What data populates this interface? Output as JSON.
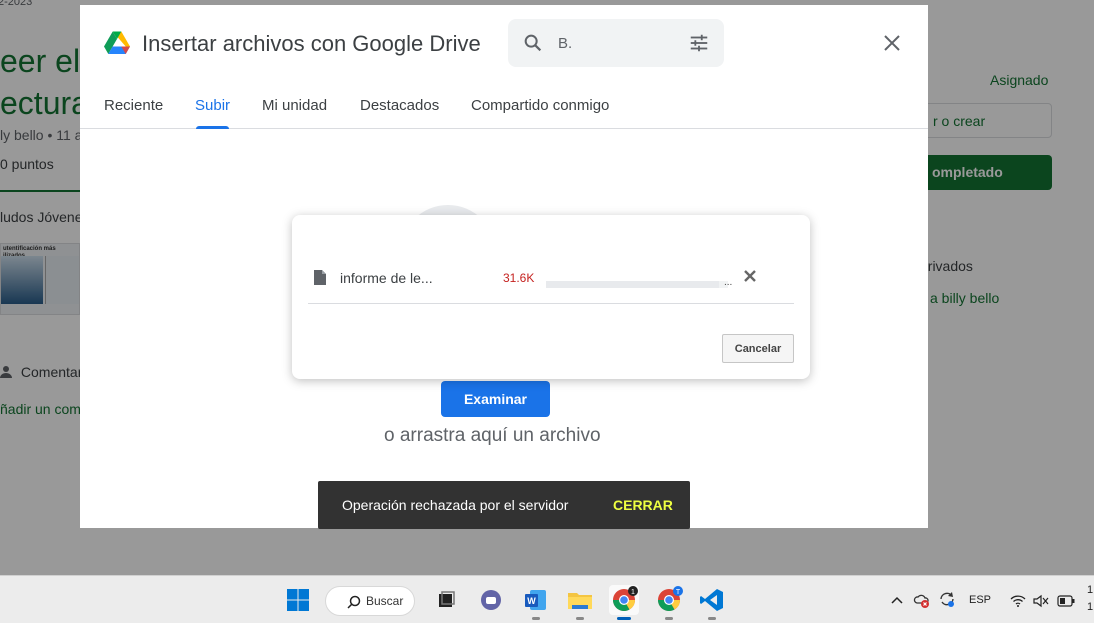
{
  "background": {
    "date_fragment": "2-2023",
    "title_line1": "eer el",
    "title_line2": "ectura",
    "author": "ly bello • 11 a",
    "points": "0 puntos",
    "description": "ludos Jóvene",
    "thumb_caption": "utentificación más\nilizados",
    "comments_label": "Comentar",
    "add_comment": "ñadir un com",
    "status_assigned": "Asignado",
    "add_or_create": "r o crear",
    "mark_done": "ompletado",
    "private_comments": "privados",
    "private_link": "a billy bello"
  },
  "dialog": {
    "title": "Insertar archivos con Google Drive",
    "search_value": "B.",
    "tabs": [
      {
        "label": "Reciente"
      },
      {
        "label": "Subir"
      },
      {
        "label": "Mi unidad"
      },
      {
        "label": "Destacados"
      },
      {
        "label": "Compartido conmigo"
      }
    ],
    "active_tab": "Subir",
    "browse_label": "Examinar",
    "drag_text": "o arrastra aquí un archivo"
  },
  "upload": {
    "file_name": "informe de le...",
    "file_size": "31.6K",
    "progress_percent": 95,
    "progress_dots": "...",
    "cancel_label": "Cancelar"
  },
  "snackbar": {
    "message": "Operación rechazada por el servidor",
    "action": "CERRAR"
  },
  "taskbar": {
    "search_label": "Buscar",
    "language": "ESP",
    "clock_fragment_1": "1",
    "clock_fragment_2": "1",
    "chrome_badge_1": "1",
    "chrome_badge_2": "T",
    "accent_color": "#005fb8"
  }
}
